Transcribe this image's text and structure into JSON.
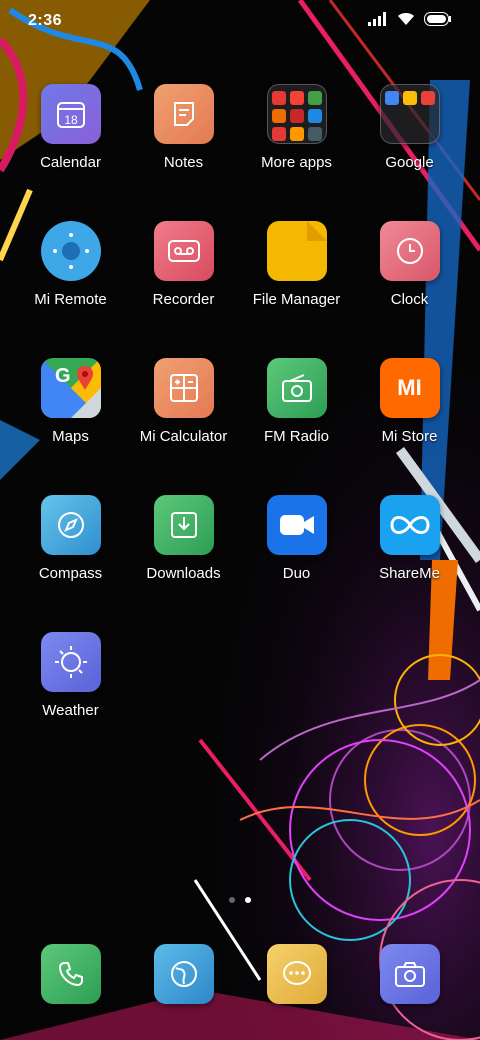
{
  "status_bar": {
    "time": "2:36",
    "signal_icon": "signal-icon",
    "wifi_icon": "wifi-icon",
    "battery_icon": "battery-icon"
  },
  "apps": [
    {
      "label": "Calendar",
      "icon": "calendar-icon",
      "badge_text": "18"
    },
    {
      "label": "Notes",
      "icon": "notes-icon"
    },
    {
      "label": "More apps",
      "icon": "folder-icon"
    },
    {
      "label": "Google",
      "icon": "folder-icon"
    },
    {
      "label": "Mi Remote",
      "icon": "remote-icon"
    },
    {
      "label": "Recorder",
      "icon": "recorder-icon"
    },
    {
      "label": "File Manager",
      "icon": "folder-file-icon"
    },
    {
      "label": "Clock",
      "icon": "clock-icon"
    },
    {
      "label": "Maps",
      "icon": "maps-icon",
      "badge_text": "G"
    },
    {
      "label": "Mi Calculator",
      "icon": "calculator-icon"
    },
    {
      "label": "FM Radio",
      "icon": "radio-icon"
    },
    {
      "label": "Mi Store",
      "icon": "mi-store-icon",
      "badge_text": "MI"
    },
    {
      "label": "Compass",
      "icon": "compass-icon"
    },
    {
      "label": "Downloads",
      "icon": "downloads-icon"
    },
    {
      "label": "Duo",
      "icon": "duo-icon"
    },
    {
      "label": "ShareMe",
      "icon": "shareme-icon"
    },
    {
      "label": "Weather",
      "icon": "weather-icon"
    }
  ],
  "dock": [
    {
      "icon": "phone-icon"
    },
    {
      "icon": "browser-icon"
    },
    {
      "icon": "messages-icon"
    },
    {
      "icon": "camera-icon"
    }
  ],
  "pager": {
    "pages": 2,
    "active": 2
  }
}
